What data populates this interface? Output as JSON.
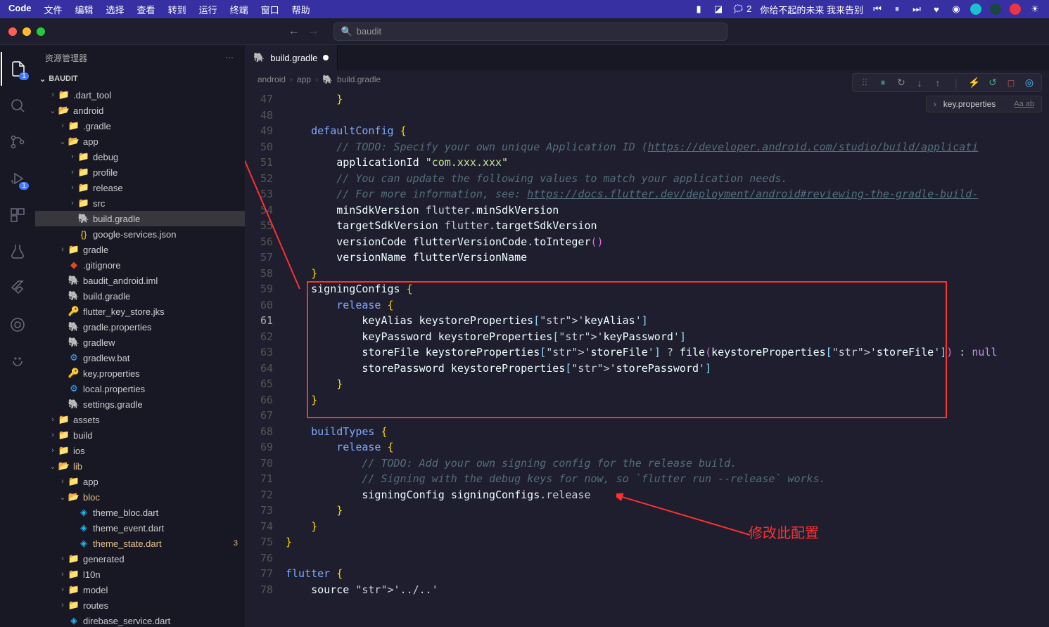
{
  "menu": {
    "app": "Code",
    "items": [
      "文件",
      "编辑",
      "选择",
      "查看",
      "转到",
      "运行",
      "终端",
      "窗口",
      "帮助"
    ],
    "wechat_count": "2",
    "song": "你给不起的未来 我来告别"
  },
  "search": {
    "placeholder": "baudit"
  },
  "sidebar": {
    "title": "资源管理器",
    "project": "BAUDIT",
    "tree": [
      {
        "d": 1,
        "chev": "›",
        "icon": "folder",
        "color": "green",
        "label": ".dart_tool"
      },
      {
        "d": 1,
        "chev": "⌄",
        "icon": "folder-open",
        "color": "green",
        "label": "android"
      },
      {
        "d": 2,
        "chev": "›",
        "icon": "folder",
        "color": "red",
        "label": ".gradle"
      },
      {
        "d": 2,
        "chev": "⌄",
        "icon": "folder-open",
        "color": "red",
        "label": "app"
      },
      {
        "d": 3,
        "chev": "›",
        "icon": "folder",
        "color": "yellow",
        "label": "debug"
      },
      {
        "d": 3,
        "chev": "›",
        "icon": "folder",
        "color": "",
        "label": "profile"
      },
      {
        "d": 3,
        "chev": "›",
        "icon": "folder",
        "color": "",
        "label": "release"
      },
      {
        "d": 3,
        "chev": "›",
        "icon": "folder",
        "color": "green",
        "label": "src"
      },
      {
        "d": 3,
        "chev": "",
        "icon": "gradle",
        "color": "",
        "label": "build.gradle",
        "sel": true
      },
      {
        "d": 3,
        "chev": "",
        "icon": "json",
        "color": "",
        "label": "google-services.json"
      },
      {
        "d": 2,
        "chev": "›",
        "icon": "folder",
        "color": "red",
        "label": "gradle"
      },
      {
        "d": 2,
        "chev": "",
        "icon": "git",
        "color": "",
        "label": ".gitignore"
      },
      {
        "d": 2,
        "chev": "",
        "icon": "gradle",
        "color": "",
        "label": "baudit_android.iml"
      },
      {
        "d": 2,
        "chev": "",
        "icon": "gradle",
        "color": "",
        "label": "build.gradle"
      },
      {
        "d": 2,
        "chev": "",
        "icon": "key",
        "color": "",
        "label": "flutter_key_store.jks"
      },
      {
        "d": 2,
        "chev": "",
        "icon": "gradle",
        "color": "",
        "label": "gradle.properties"
      },
      {
        "d": 2,
        "chev": "",
        "icon": "gradle",
        "color": "",
        "label": "gradlew"
      },
      {
        "d": 2,
        "chev": "",
        "icon": "gear",
        "color": "",
        "label": "gradlew.bat"
      },
      {
        "d": 2,
        "chev": "",
        "icon": "key",
        "color": "",
        "label": "key.properties"
      },
      {
        "d": 2,
        "chev": "",
        "icon": "gear",
        "color": "",
        "label": "local.properties"
      },
      {
        "d": 2,
        "chev": "",
        "icon": "gradle",
        "color": "",
        "label": "settings.gradle"
      },
      {
        "d": 1,
        "chev": "›",
        "icon": "folder",
        "color": "yellow",
        "label": "assets"
      },
      {
        "d": 1,
        "chev": "›",
        "icon": "folder",
        "color": "red",
        "label": "build"
      },
      {
        "d": 1,
        "chev": "›",
        "icon": "folder",
        "color": "",
        "label": "ios"
      },
      {
        "d": 1,
        "chev": "⌄",
        "icon": "folder-open",
        "color": "yellow",
        "label": "lib",
        "mod": true
      },
      {
        "d": 2,
        "chev": "›",
        "icon": "folder",
        "color": "green",
        "label": "app"
      },
      {
        "d": 2,
        "chev": "⌄",
        "icon": "folder-open",
        "color": "",
        "label": "bloc",
        "mod": true
      },
      {
        "d": 3,
        "chev": "",
        "icon": "dart",
        "color": "",
        "label": "theme_bloc.dart"
      },
      {
        "d": 3,
        "chev": "",
        "icon": "dart",
        "color": "",
        "label": "theme_event.dart"
      },
      {
        "d": 3,
        "chev": "",
        "icon": "dart",
        "color": "",
        "label": "theme_state.dart",
        "mod": true,
        "badge": "3"
      },
      {
        "d": 2,
        "chev": "›",
        "icon": "folder",
        "color": "red",
        "label": "generated"
      },
      {
        "d": 2,
        "chev": "›",
        "icon": "folder",
        "color": "blue",
        "label": "l10n"
      },
      {
        "d": 2,
        "chev": "›",
        "icon": "folder",
        "color": "red",
        "label": "model"
      },
      {
        "d": 2,
        "chev": "›",
        "icon": "folder",
        "color": "green",
        "label": "routes"
      },
      {
        "d": 2,
        "chev": "",
        "icon": "dart",
        "color": "",
        "label": "direbase_service.dart"
      }
    ]
  },
  "tab": {
    "label": "build.gradle"
  },
  "breadcrumb": [
    "android",
    "app",
    "build.gradle"
  ],
  "dropdown": {
    "label": "key.properties",
    "opts": "Aa ab"
  },
  "code": {
    "start": 47,
    "current": 61,
    "lines": [
      "        }",
      "",
      "    defaultConfig {",
      "        // TODO: Specify your own unique Application ID (https://developer.android.com/studio/build/applicati",
      "        applicationId \"com.xxx.xxx\"",
      "        // You can update the following values to match your application needs.",
      "        // For more information, see: https://docs.flutter.dev/deployment/android#reviewing-the-gradle-build-",
      "        minSdkVersion flutter.minSdkVersion",
      "        targetSdkVersion flutter.targetSdkVersion",
      "        versionCode flutterVersionCode.toInteger()",
      "        versionName flutterVersionName",
      "    }",
      "    signingConfigs {",
      "        release {",
      "            keyAlias keystoreProperties['keyAlias']",
      "            keyPassword keystoreProperties['keyPassword']",
      "            storeFile keystoreProperties['storeFile'] ? file(keystoreProperties['storeFile']) : null",
      "            storePassword keystoreProperties['storePassword']",
      "        }",
      "    }",
      "",
      "    buildTypes {",
      "        release {",
      "            // TODO: Add your own signing config for the release build.",
      "            // Signing with the debug keys for now, so `flutter run --release` works.",
      "            signingConfig signingConfigs.release",
      "        }",
      "    }",
      "}",
      "",
      "flutter {",
      "    source '../..'"
    ]
  },
  "annotation": {
    "text": "修改此配置"
  },
  "activity_badge": {
    "explorer": "1",
    "debug": "1"
  }
}
